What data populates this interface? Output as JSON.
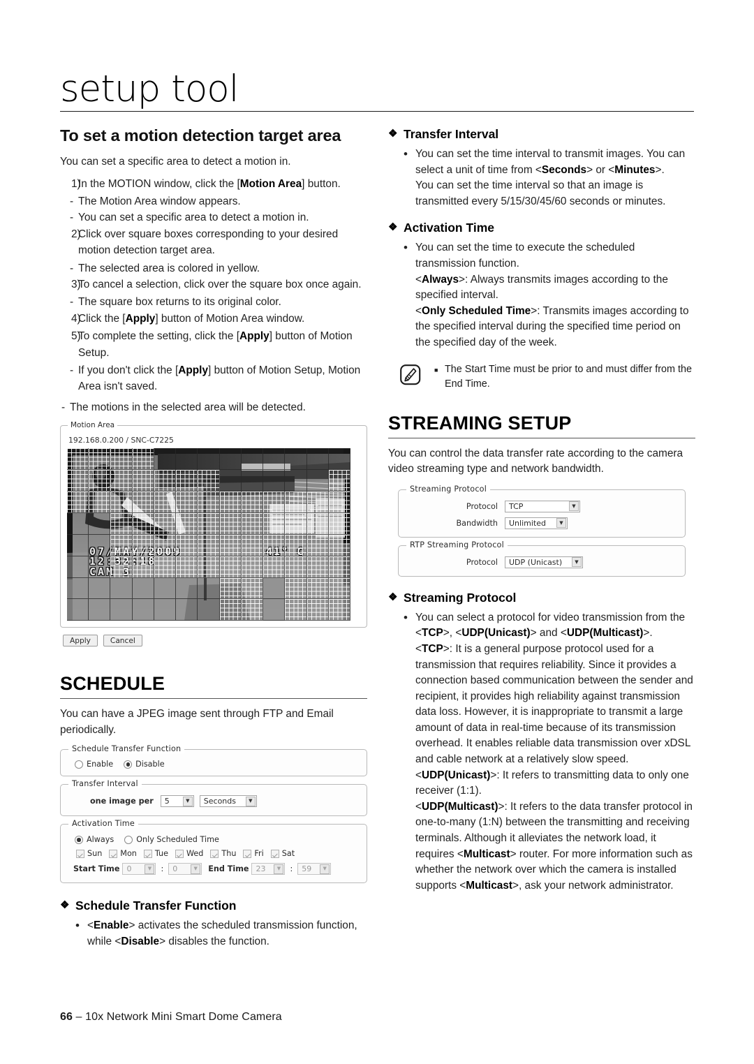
{
  "masthead": {
    "title": "setup tool"
  },
  "left": {
    "heading": "To set a motion detection target area",
    "intro": "You can set a specific area to detect a motion in.",
    "steps": [
      {
        "num": "1)",
        "text_pre": "In the MOTION window, click the [",
        "bold": "Motion Area",
        "text_post": "] button.",
        "subs": [
          "The Motion Area window appears.",
          "You can set a specific area to detect a motion in."
        ]
      },
      {
        "num": "2)",
        "text_pre": "Click over square boxes corresponding to your desired motion detection target area.",
        "bold": "",
        "text_post": "",
        "subs": [
          "The selected area is colored in yellow."
        ]
      },
      {
        "num": "3)",
        "text_pre": "To cancel a selection, click over the square box once again.",
        "bold": "",
        "text_post": "",
        "subs": [
          "The square box returns to its original color."
        ]
      },
      {
        "num": "4)",
        "text_pre": "Click the [",
        "bold": "Apply",
        "text_post": "] button of Motion Area window.",
        "subs": []
      },
      {
        "num": "5)",
        "text_pre": "To complete the setting, click the [",
        "bold": "Apply",
        "text_post": "] button of Motion Setup.",
        "subs": []
      }
    ],
    "step5_sub_pre": "If you don't click the [",
    "step5_sub_bold": "Apply",
    "step5_sub_post": "] button of Motion Setup, Motion Area isn't saved.",
    "final_dash": "The motions in the selected area will be detected."
  },
  "motion_area": {
    "legend": "Motion Area",
    "device": "192.168.0.200 / SNC-C7225",
    "osd_date": "07/MAY/2009",
    "osd_time": "12:32:18",
    "osd_cam": "CAM 3",
    "osd_temp": "41° C",
    "apply_label": "Apply",
    "cancel_label": "Cancel"
  },
  "schedule": {
    "heading": "SCHEDULE",
    "intro": "You can have a JPEG image sent through FTP and Email periodically.",
    "panel1": {
      "legend": "Schedule Transfer Function",
      "enable_label": "Enable",
      "disable_label": "Disable",
      "selected": "Disable"
    },
    "panel2": {
      "legend": "Transfer Interval",
      "prefix_label": "one image per",
      "value": "5",
      "unit": "Seconds"
    },
    "panel3": {
      "legend": "Activation Time",
      "always_label": "Always",
      "only_scheduled_label": "Only Scheduled Time",
      "selected": "Always",
      "days": [
        "Sun",
        "Mon",
        "Tue",
        "Wed",
        "Thu",
        "Fri",
        "Sat"
      ],
      "start_label": "Start Time",
      "start_hour": "0",
      "start_min": "0",
      "end_label": "End Time",
      "end_hour": "23",
      "end_min": "59"
    },
    "stf_heading": "Schedule Transfer Function",
    "stf_b1": "activates the scheduled transmission function, while",
    "stf_b1_bold1": "Enable",
    "stf_b1_bold2": "Disable",
    "stf_b1_tail": "disables the function."
  },
  "right": {
    "transfer_interval": {
      "heading": "Transfer Interval",
      "line1": "You can set the time interval to transmit images. You can select a unit of time from <",
      "bold1": "Seconds",
      "mid1": "> or <",
      "bold2": "Minutes",
      "tail1": ">.",
      "line2": "You can set the time interval so that an image is transmitted every 5/15/30/45/60 seconds or minutes."
    },
    "activation_time": {
      "heading": "Activation Time",
      "line1": "You can set the time to execute the scheduled transmission function.",
      "always_bold": "Always",
      "always_text": ": Always transmits images according to the specified interval.",
      "ost_bold": "Only Scheduled Time",
      "ost_text": ": Transmits images according to the specified interval during the specified time period on the specified day of the week."
    },
    "note": {
      "icon": "memo-pen-icon",
      "text": "The Start Time must be prior to and must differ from the End Time."
    },
    "streaming_setup": {
      "heading": "STREAMING SETUP",
      "intro": "You can control the data transfer rate according to the camera video streaming type and network bandwidth."
    },
    "panel_streaming": {
      "legend": "Streaming Protocol",
      "protocol_label": "Protocol",
      "protocol_value": "TCP",
      "bandwidth_label": "Bandwidth",
      "bandwidth_value": "Unlimited"
    },
    "panel_rtp": {
      "legend": "RTP Streaming Protocol",
      "protocol_label": "Protocol",
      "protocol_value": "UDP (Unicast)"
    },
    "streaming_protocol": {
      "heading": "Streaming Protocol",
      "sel_pre": "You can select a protocol for video transmission from the <",
      "sel_b1": "TCP",
      "sel_m1": ">, <",
      "sel_b2": "UDP(Unicast)",
      "sel_m2": "> and <",
      "sel_b3": "UDP(Multicast)",
      "sel_tail": ">.",
      "tcp_bold": "TCP",
      "tcp_text": ": It is a general purpose protocol used for a transmission that requires reliability. Since it provides a connection based communication between the sender and recipient, it provides high reliability against transmission data loss. However, it is inappropriate to transmit a large amount of data in real-time because of its transmission overhead. It enables reliable data transmission over xDSL and cable network at a relatively slow speed.",
      "uni_bold": "UDP(Unicast)",
      "uni_text": ": It refers to transmitting data to only one receiver (1:1).",
      "multi_bold": "UDP(Multicast)",
      "multi_text_a": ": It refers to the data transfer protocol in one-to-many (1:N) between the transmitting and receiving terminals. Although it alleviates the network load, it requires <",
      "multi_bold2": "Multicast",
      "multi_text_b": "> router. For more information such as whether the network over which the camera is installed supports <",
      "multi_bold3": "Multicast",
      "multi_text_c": ">, ask your network administrator."
    }
  },
  "footer": {
    "page": "66",
    "dash": "–",
    "title": "10x Network Mini Smart Dome Camera"
  }
}
